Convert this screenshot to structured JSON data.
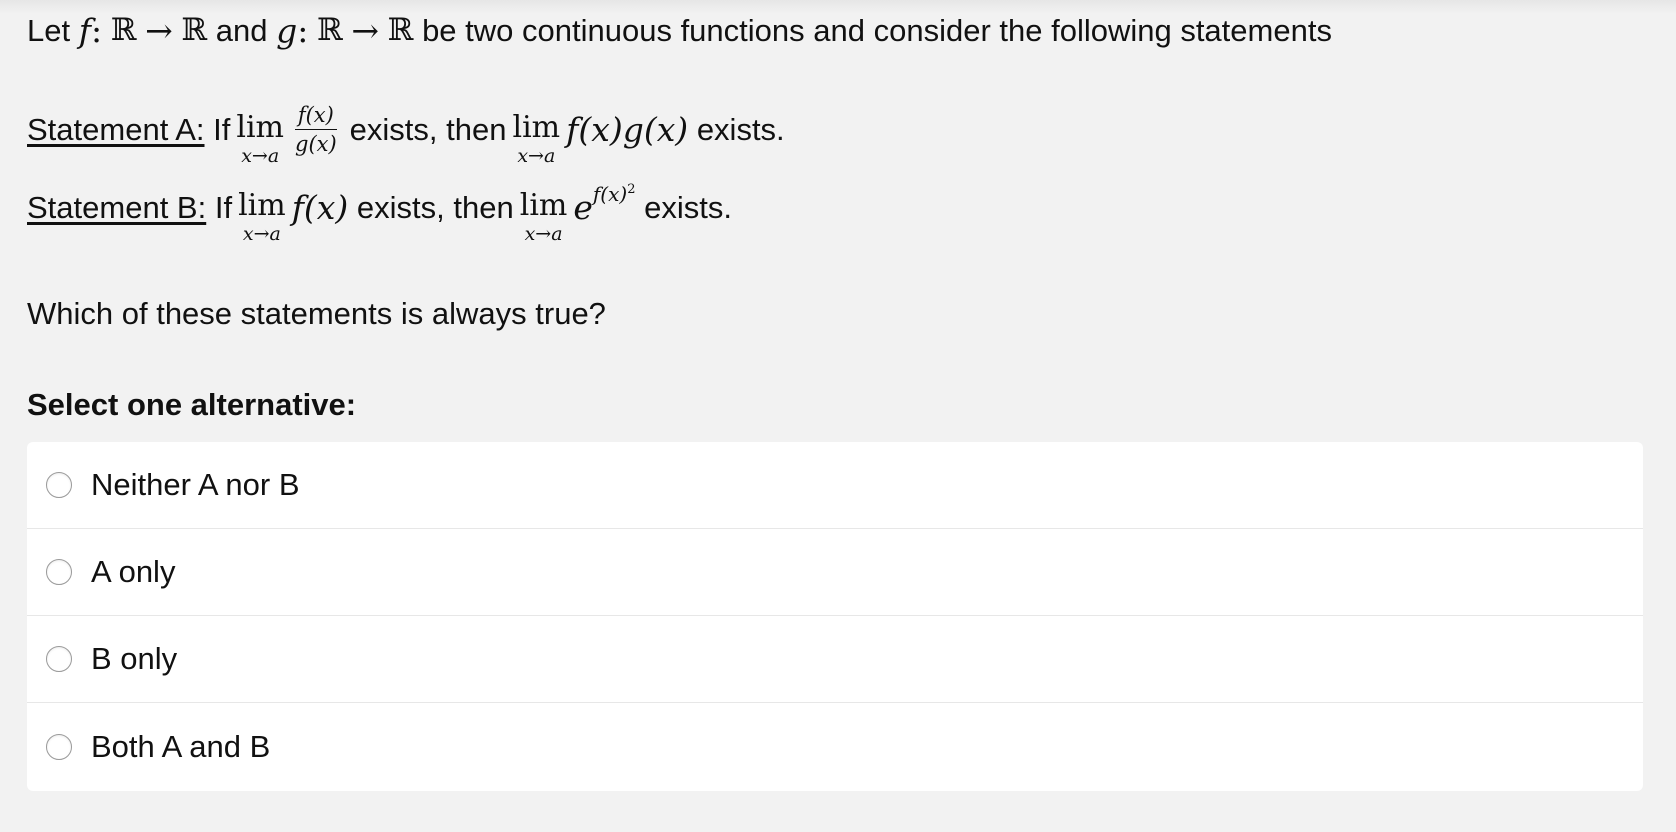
{
  "intro": {
    "let": "Let",
    "f": "f",
    "colon1": ":",
    "R1": "ℝ",
    "arrow1": "→",
    "R2": "ℝ",
    "and": "and",
    "g": "g",
    "colon2": ":",
    "R3": "ℝ",
    "arrow2": "→",
    "R4": "ℝ",
    "rest": "be two continuous functions and consider the following statements"
  },
  "statement_a": {
    "label": "Statement A:",
    "if": "If",
    "lim": "lim",
    "lim_sub": "x→a",
    "num": "f(x)",
    "den": "g(x)",
    "exists_then": "exists, then",
    "lim2": "lim",
    "lim2_sub": "x→a",
    "expr": "f(x)g(x)",
    "exists": "exists."
  },
  "statement_b": {
    "label": "Statement B:",
    "if": "If",
    "lim": "lim",
    "lim_sub": "x→a",
    "expr": "f(x)",
    "exists_then": "exists, then",
    "lim2": "lim",
    "lim2_sub": "x→a",
    "base": "e",
    "exponent": "f(x)",
    "exponent_power": "2",
    "exists": "exists."
  },
  "question": "Which of these statements is always true?",
  "select_heading": "Select one alternative:",
  "options": [
    {
      "label": "Neither A nor B",
      "selected": false
    },
    {
      "label": "A only",
      "selected": false
    },
    {
      "label": "B only",
      "selected": false
    },
    {
      "label": "Both A and B",
      "selected": false
    }
  ]
}
